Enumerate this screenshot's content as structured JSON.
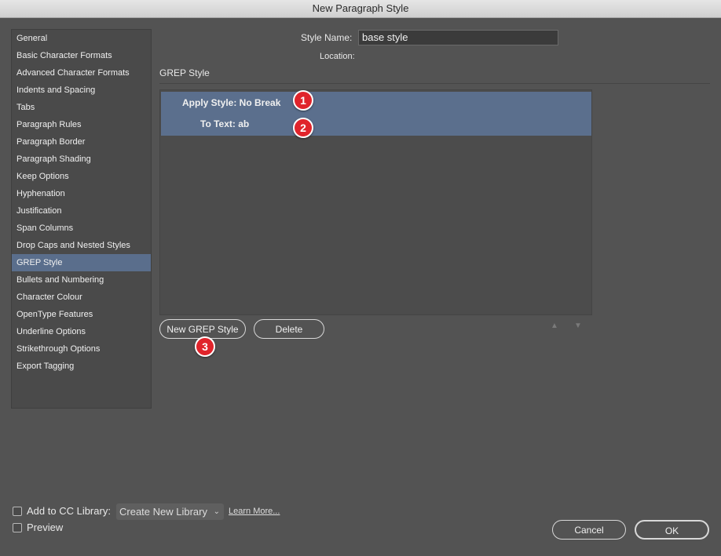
{
  "window": {
    "title": "New Paragraph Style"
  },
  "sidebar": {
    "items": [
      {
        "label": "General"
      },
      {
        "label": "Basic Character Formats"
      },
      {
        "label": "Advanced Character Formats"
      },
      {
        "label": "Indents and Spacing"
      },
      {
        "label": "Tabs"
      },
      {
        "label": "Paragraph Rules"
      },
      {
        "label": "Paragraph Border"
      },
      {
        "label": "Paragraph Shading"
      },
      {
        "label": "Keep Options"
      },
      {
        "label": "Hyphenation"
      },
      {
        "label": "Justification"
      },
      {
        "label": "Span Columns"
      },
      {
        "label": "Drop Caps and Nested Styles"
      },
      {
        "label": "GREP Style",
        "selected": true
      },
      {
        "label": "Bullets and Numbering"
      },
      {
        "label": "Character Colour"
      },
      {
        "label": "OpenType Features"
      },
      {
        "label": "Underline Options"
      },
      {
        "label": "Strikethrough Options"
      },
      {
        "label": "Export Tagging"
      }
    ]
  },
  "header": {
    "style_name_label": "Style Name:",
    "style_name_value": "base style",
    "location_label": "Location:"
  },
  "section": {
    "title": "GREP Style"
  },
  "grep": {
    "apply_style": "Apply Style: No Break",
    "to_text": "To Text: ab"
  },
  "buttons": {
    "new_grep_style": "New GREP Style",
    "delete": "Delete",
    "cancel": "Cancel",
    "ok": "OK"
  },
  "badges": {
    "one": "1",
    "two": "2",
    "three": "3"
  },
  "footer": {
    "add_to_cc_library": "Add to CC Library:",
    "library_select": "Create New Library",
    "learn_more": "Learn More...",
    "preview": "Preview"
  },
  "colors": {
    "background": "#535353",
    "selection": "#5a6e8c",
    "badge": "#e0242b"
  }
}
